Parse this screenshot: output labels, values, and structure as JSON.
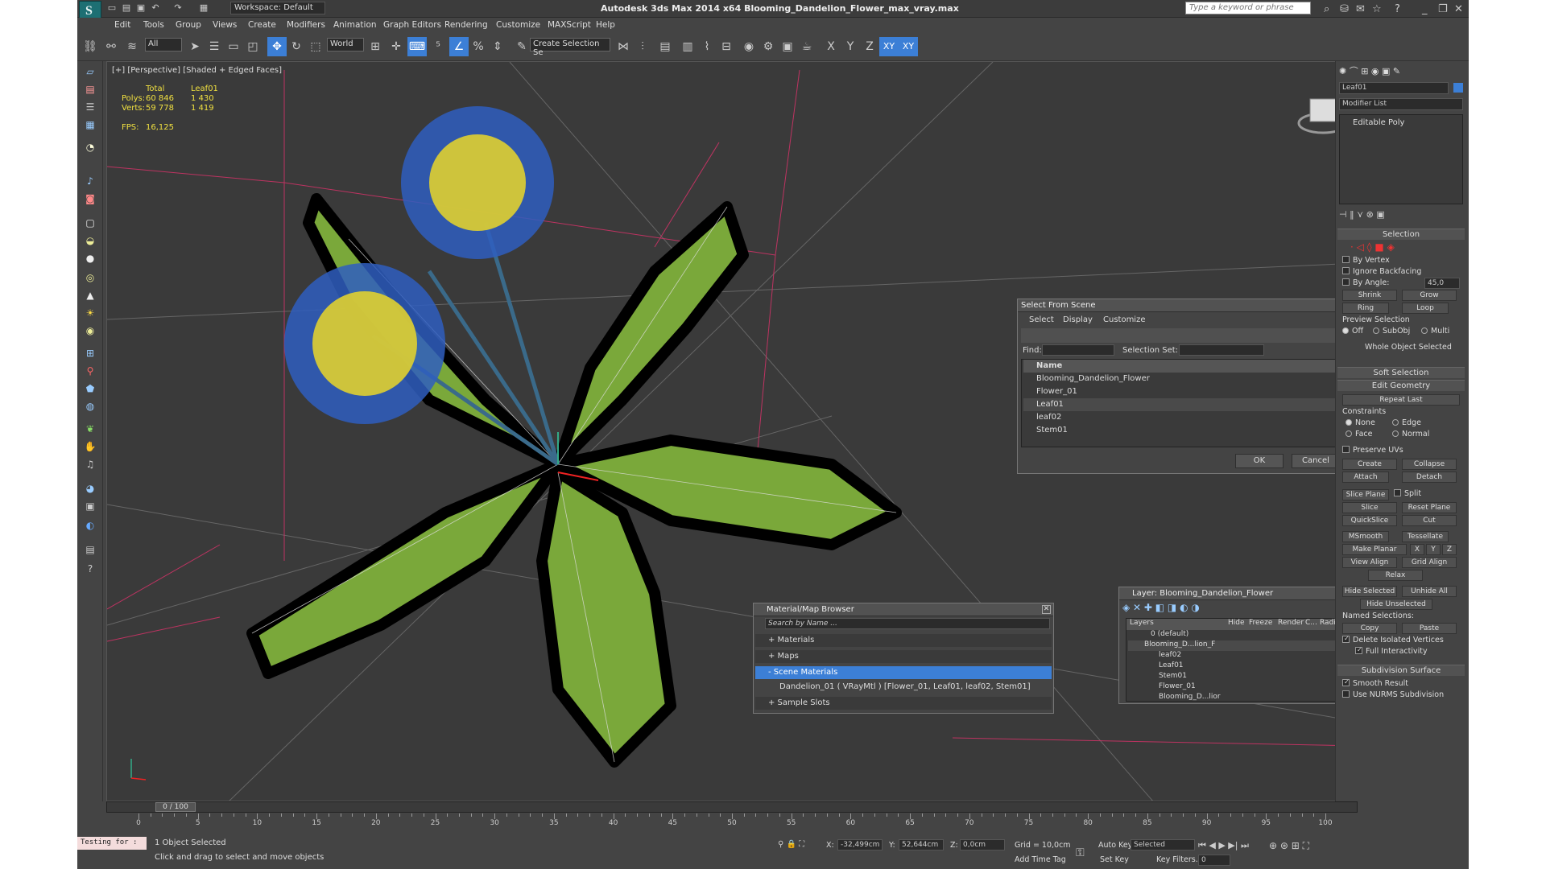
{
  "app": {
    "title": "Autodesk 3ds Max  2014 x64     Blooming_Dandelion_Flower_max_vray.max",
    "workspace": "Workspace: Default",
    "search_placeholder": "Type a keyword or phrase"
  },
  "menu": [
    "Edit",
    "Tools",
    "Group",
    "Views",
    "Create",
    "Modifiers",
    "Animation",
    "Graph Editors",
    "Rendering",
    "Customize",
    "MAXScript",
    "Help"
  ],
  "toolbar": {
    "filter": "All",
    "coord": "World",
    "selection_set": "Create Selection Se",
    "axes": [
      "X",
      "Y",
      "Z",
      "XY",
      "XY"
    ]
  },
  "viewport": {
    "label": "[+] [Perspective] [Shaded + Edged Faces]",
    "stats": {
      "total_label": "Total",
      "object_label": "Leaf01",
      "polys_label": "Polys:",
      "polys_total": "60 846",
      "polys_obj": "1 430",
      "verts_label": "Verts:",
      "verts_total": "59 778",
      "verts_obj": "1 419",
      "fps_label": "FPS:",
      "fps_value": "16,125"
    }
  },
  "select_from_scene": {
    "title": "Select From Scene",
    "menu": [
      "Select",
      "Display",
      "Customize"
    ],
    "find_label": "Find:",
    "selset_label": "Selection Set:",
    "column": "Name",
    "items": [
      "Blooming_Dandelion_Flower",
      "Flower_01",
      "Leaf01",
      "leaf02",
      "Stem01"
    ],
    "ok": "OK",
    "cancel": "Cancel"
  },
  "material_browser": {
    "title": "Material/Map Browser",
    "search_placeholder": "Search by Name ...",
    "sections": [
      "+ Materials",
      "+ Maps",
      "- Scene Materials"
    ],
    "material": "Dandelion_01  ( VRayMtl ) [Flower_01, Leaf01, leaf02, Stem01]",
    "last": "+ Sample Slots"
  },
  "layer_window": {
    "title": "Layer: Blooming_Dandelion_Flower",
    "columns": [
      "Layers",
      "Hide",
      "Freeze",
      "Render",
      "C...",
      "Radiosity"
    ],
    "rows": [
      "0 (default)",
      "Blooming_D...lion_F",
      "leaf02",
      "Leaf01",
      "Stem01",
      "Flower_01",
      "Blooming_D...lior"
    ]
  },
  "command_panel": {
    "object_name": "Leaf01",
    "modifier_list": "Modifier List",
    "stack_item": "Editable Poly",
    "selection": {
      "title": "Selection",
      "by_vertex": "By Vertex",
      "ignore_backfacing": "Ignore Backfacing",
      "by_angle": "By Angle:",
      "by_angle_value": "45,0",
      "shrink": "Shrink",
      "grow": "Grow",
      "ring": "Ring",
      "loop": "Loop",
      "preview": "Preview Selection",
      "off": "Off",
      "subobj": "SubObj",
      "multi": "Multi",
      "status": "Whole Object Selected"
    },
    "soft_selection": "Soft Selection",
    "edit_geometry": {
      "title": "Edit Geometry",
      "repeat_last": "Repeat Last",
      "constraints": "Constraints",
      "none": "None",
      "edge": "Edge",
      "face": "Face",
      "normal": "Normal",
      "preserve_uvs": "Preserve UVs",
      "create": "Create",
      "collapse": "Collapse",
      "attach": "Attach",
      "detach": "Detach",
      "slice_plane": "Slice Plane",
      "split": "Split",
      "slice": "Slice",
      "reset_plane": "Reset Plane",
      "quickslice": "QuickSlice",
      "cut": "Cut",
      "msmooth": "MSmooth",
      "tessellate": "Tessellate",
      "make_planar": "Make Planar",
      "x": "X",
      "y": "Y",
      "z": "Z",
      "view_align": "View Align",
      "grid_align": "Grid Align",
      "relax": "Relax",
      "hide_selected": "Hide Selected",
      "unhide_all": "Unhide All",
      "hide_unselected": "Hide Unselected",
      "named_selections": "Named Selections:",
      "copy": "Copy",
      "paste": "Paste",
      "delete_isolated": "Delete Isolated Vertices",
      "full_interactivity": "Full Interactivity"
    },
    "subdivision": {
      "title": "Subdivision Surface",
      "smooth_result": "Smooth Result",
      "use_nurms": "Use NURMS Subdivision"
    }
  },
  "timeline": {
    "frame": "0 / 100",
    "ticks": [
      "0",
      "5",
      "10",
      "15",
      "20",
      "25",
      "30",
      "35",
      "40",
      "45",
      "50",
      "55",
      "60",
      "65",
      "70",
      "75",
      "80",
      "85",
      "90",
      "95",
      "100"
    ]
  },
  "status": {
    "maxscript": "Testing for :",
    "selected": "1 Object Selected",
    "prompt": "Click and drag to select and move objects",
    "x_label": "X:",
    "x_value": "-32,499cm",
    "y_label": "Y:",
    "y_value": "52,644cm",
    "z_label": "Z:",
    "z_value": "0,0cm",
    "grid": "Grid = 10,0cm",
    "add_time_tag": "Add Time Tag",
    "auto_key": "Auto Key",
    "selected_mode": "Selected",
    "set_key": "Set Key",
    "key_filters": "Key Filters...",
    "frame_field": "0"
  }
}
